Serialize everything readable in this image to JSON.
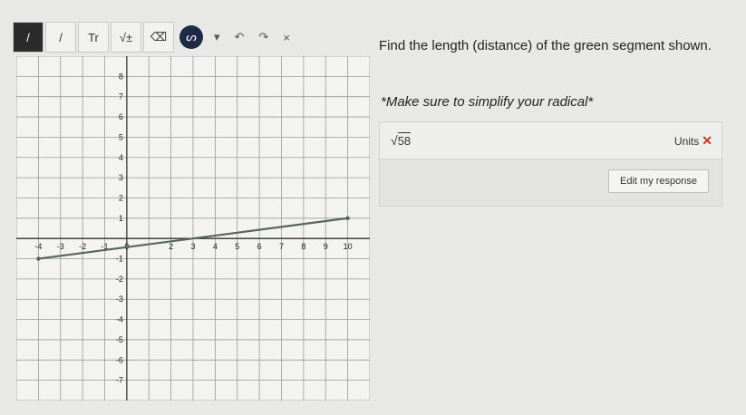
{
  "toolbar": {
    "tools": [
      {
        "name": "pen-tool",
        "glyph": "/"
      },
      {
        "name": "line-tool",
        "glyph": "/"
      },
      {
        "name": "text-tool",
        "glyph": "Tr"
      },
      {
        "name": "sqrt-tool",
        "glyph": "√±"
      },
      {
        "name": "eraser-tool",
        "glyph": "⌫"
      }
    ],
    "undo_glyph": "↶",
    "redo_glyph": "↷",
    "close_glyph": "×"
  },
  "question": {
    "text": "Find the length (distance) of the green segment shown.",
    "note": "*Make sure to simplify your radical*"
  },
  "answer": {
    "radical_symbol": "√",
    "radicand": "58",
    "units_label": "Units",
    "units_mark": "✕",
    "edit_button": "Edit my response"
  },
  "graph": {
    "x_ticks": [
      "-4",
      "-3",
      "-2",
      "-1",
      "0",
      "2",
      "3",
      "4",
      "5",
      "6",
      "7",
      "8",
      "9",
      "10"
    ],
    "y_ticks": [
      "8",
      "7",
      "6",
      "5",
      "4",
      "3",
      "2",
      "1",
      "-1",
      "-2",
      "-3",
      "-4",
      "-5",
      "-6",
      "-7"
    ],
    "segment": {
      "start": [
        -4,
        -1
      ],
      "end": [
        10,
        1
      ]
    },
    "colors": {
      "segment": "#556655",
      "grid": "#9a9a96",
      "axis": "#333333"
    }
  }
}
